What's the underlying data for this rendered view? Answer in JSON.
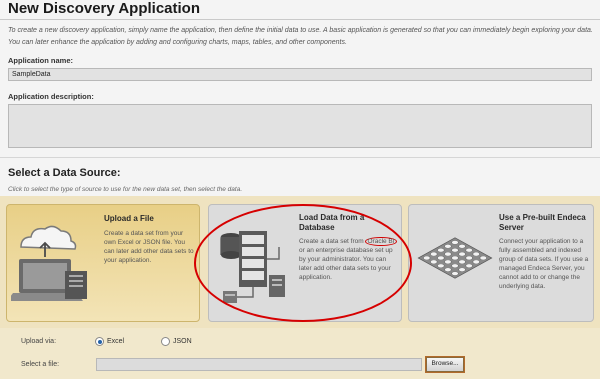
{
  "page": {
    "title": "New Discovery Application",
    "intro": "To create a new discovery application, simply name the application, then define the initial data to use. A basic application is generated so that you can immediately begin exploring your data. You can later enhance the application by adding and configuring charts, maps, tables, and other components."
  },
  "form": {
    "name_label": "Application name:",
    "name_value": "SampleData",
    "description_label": "Application description:",
    "description_value": ""
  },
  "data_source": {
    "title": "Select a Data Source:",
    "hint": "Click to select the type of source to use for the new data set, then select the data.",
    "cards": [
      {
        "title": "Upload a File",
        "description": "Create a data set from your own Excel or JSON file. You can later add other data sets to your application.",
        "icon": "laptop-file-upload-icon",
        "selected": true
      },
      {
        "title": "Load Data from a Database",
        "description_before": "Create a data set from ",
        "description_highlight": "Oracle BI",
        "description_after": " or an enterprise database set up by your administrator. You can later add other data sets to your application.",
        "icon": "database-server-icon",
        "selected": false
      },
      {
        "title": "Use a Pre-built Endeca Server",
        "description": "Connect your application to a fully assembled and indexed group of data sets. If you use a managed Endeca Server, you cannot add to or change the underlying data.",
        "icon": "endeca-grid-icon",
        "selected": false
      }
    ]
  },
  "upload": {
    "via_label": "Upload via:",
    "options": [
      "Excel",
      "JSON"
    ],
    "selected_option": "Excel",
    "file_label": "Select a file:",
    "browse_label": "Browse..."
  },
  "colors": {
    "selected_card": "#e8cf86",
    "band": "#efe3c0",
    "annotation": "#d60000",
    "radio_accent": "#2462a8"
  }
}
